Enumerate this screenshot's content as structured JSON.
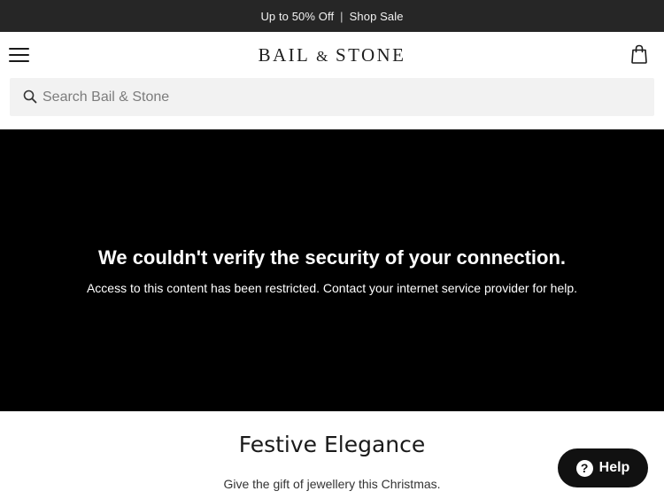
{
  "promo": {
    "offer_text": "Up to 50% Off",
    "separator": "|",
    "link_text": "Shop Sale"
  },
  "header": {
    "logo_left": "BAIL",
    "logo_amp": "&",
    "logo_right": "STONE",
    "menu_icon": "hamburger-menu-icon",
    "cart_icon": "shopping-bag-icon"
  },
  "search": {
    "placeholder": "Search Bail & Stone",
    "value": "",
    "icon": "search-icon"
  },
  "error": {
    "title": "We couldn't verify the security of your connection.",
    "message": "Access to this content has been restricted. Contact your internet service provider for help."
  },
  "section": {
    "title": "Festive Elegance",
    "subtitle": "Give the gift of jewellery this Christmas."
  },
  "help": {
    "label": "Help",
    "icon_glyph": "?"
  },
  "colors": {
    "promo_bg": "#262626",
    "search_bg": "#f2f2f2",
    "error_bg": "#000000",
    "help_bg": "#111111"
  }
}
